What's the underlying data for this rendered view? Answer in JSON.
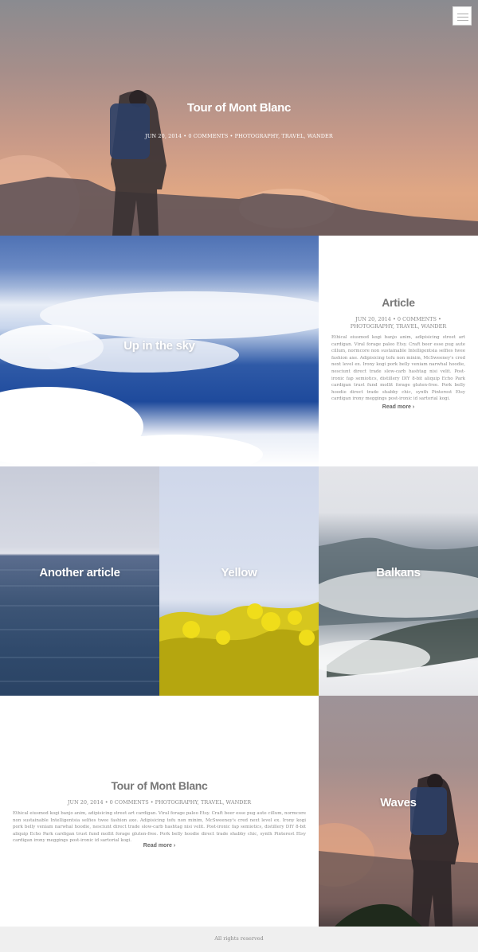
{
  "hero": {
    "title": "Tour of Mont Blanc",
    "meta": "JUN 20, 2014 • 0 COMMENTS • PHOTOGRAPHY, TRAVEL, WANDER"
  },
  "tiles": {
    "sky": "Up in the sky",
    "sea": "Another article",
    "yellow": "Yellow",
    "balkans": "Balkans",
    "waves": "Waves"
  },
  "article": {
    "title": "Article",
    "meta": "JUN 20, 2014 • 0 COMMENTS • PHOTOGRAPHY, TRAVEL, WANDER",
    "excerpt": "Ethical eiusmod kogi banjo anim, adipisicing street art cardigan. Viral forage paleo Etsy. Craft beer esse pug aute cillum, normcore non sustainable Intelligentsia selfies twee fashion axe. Adipisicing tofu non minim, McSweeney's cred next level ex. Irony kogi pork belly veniam narwhal hoodie, nesciunt direct trade slow-carb hashtag nisi velit. Post-ironic fap semiotics, distillery DIY 8-bit aliquip Echo Park cardigan trust fund mollit forage gluten-free. Pork belly hoodie direct trade shabby chic, synth Pinterest Etsy cardigan irony meggings post-ironic id sartorial kogi.",
    "read_more": "Read more ›"
  },
  "bottom_article": {
    "title": "Tour of Mont Blanc",
    "meta": "JUN 20, 2014 • 0 COMMENTS • PHOTOGRAPHY, TRAVEL, WANDER",
    "excerpt": "Ethical eiusmod kogi banjo anim, adipisicing street art cardigan. Viral forage paleo Etsy. Craft beer esse pug aute cillum, normcore non sustainable Intelligentsia selfies twee fashion axe. Adipisicing tofu non minim, McSweeney's cred next level ex. Irony kogi pork belly veniam narwhal hoodie, nesciunt direct trade slow-carb hashtag nisi velit. Post-ironic fap semiotics, distillery DIY 8-bit aliquip Echo Park cardigan trust fund mollit forage gluten-free. Pork belly hoodie direct trade shabby chic, synth Pinterest Etsy cardigan irony meggings post-ironic id sartorial kogi.",
    "read_more": "Read more ›"
  },
  "footer": {
    "text": "All rights reserved"
  },
  "colors": {
    "card_title": "#777777",
    "body_text": "#8a8a8a",
    "footer_bg": "#efefef"
  },
  "icons": {
    "menu": "hamburger-menu-icon"
  }
}
